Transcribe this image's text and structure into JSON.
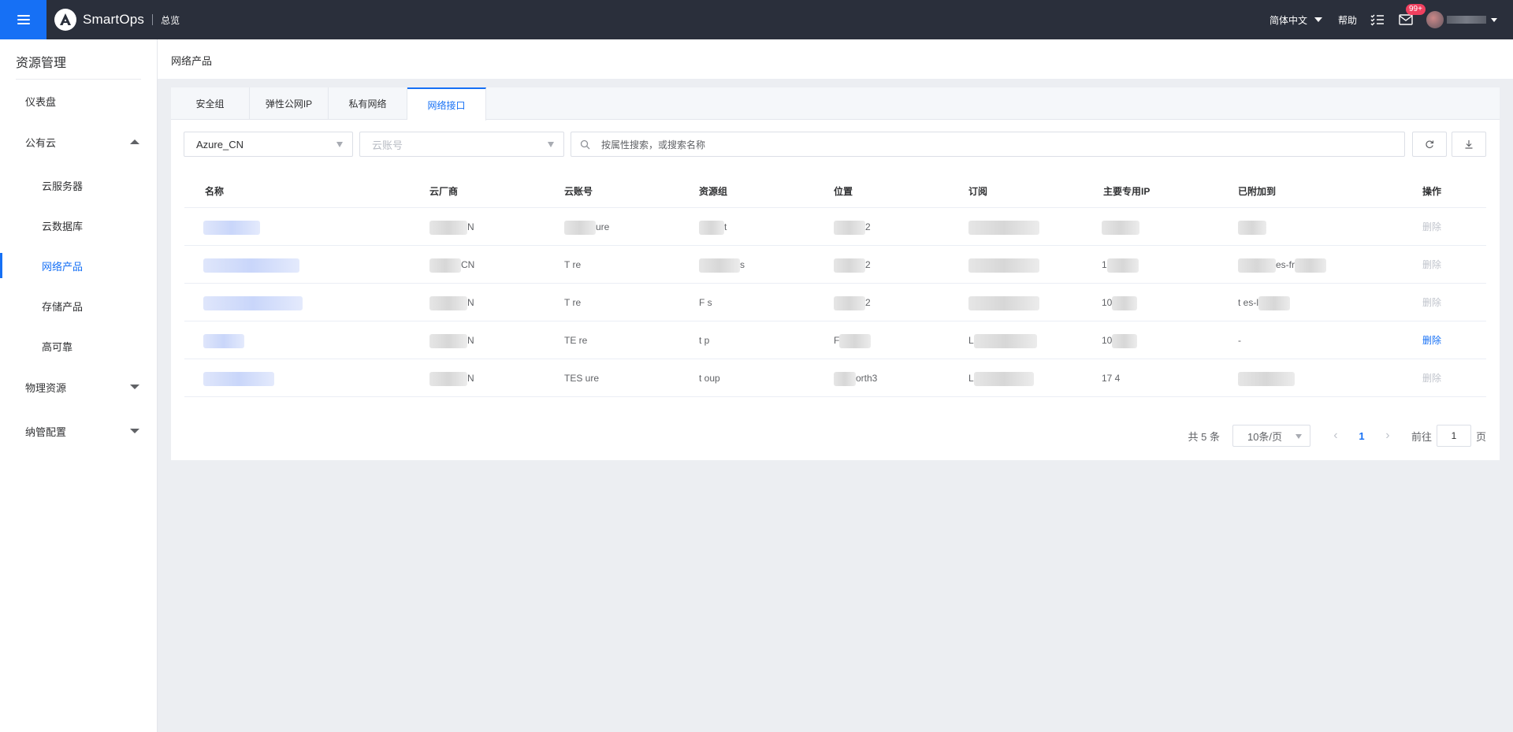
{
  "topbar": {
    "brand": "SmartOps",
    "overview": "总览",
    "language": "简体中文",
    "help": "帮助",
    "mail_badge": "99+",
    "icons": [
      "menu-icon",
      "tasks-icon",
      "mail-icon",
      "avatar"
    ]
  },
  "sidebar": {
    "title": "资源管理",
    "items": [
      {
        "label": "仪表盘"
      },
      {
        "label": "公有云"
      },
      {
        "label": "云服务器"
      },
      {
        "label": "云数据库"
      },
      {
        "label": "网络产品"
      },
      {
        "label": "存储产品"
      },
      {
        "label": "高可靠"
      },
      {
        "label": "物理资源"
      },
      {
        "label": "纳管配置"
      }
    ]
  },
  "breadcrumb": "网络产品",
  "tabs": [
    {
      "label": "安全组"
    },
    {
      "label": "弹性公网IP"
    },
    {
      "label": "私有网络"
    },
    {
      "label": "网络接口",
      "active": true
    }
  ],
  "filters": {
    "provider": "Azure_CN",
    "account_placeholder": "云账号",
    "search_placeholder": "按属性搜索，或搜索名称"
  },
  "table": {
    "columns": [
      "名称",
      "云厂商",
      "云账号",
      "资源组",
      "位置",
      "订阅",
      "主要专用IP",
      "已附加到",
      "操作"
    ],
    "rows": [
      {
        "vendor": "N",
        "account": "ure",
        "group": "t",
        "location": "2",
        "ip": "",
        "attached": "",
        "action": "删除",
        "action_enabled": false
      },
      {
        "vendor": "CN",
        "account": "T         re",
        "group": "s",
        "location": "2",
        "ip": "1",
        "attached": "es-fr",
        "action": "删除",
        "action_enabled": false
      },
      {
        "vendor": "N",
        "account": "T         re",
        "group": "F         s",
        "location": "2",
        "ip": "10",
        "attached": "t       es-l",
        "action": "删除",
        "action_enabled": false
      },
      {
        "vendor": "N",
        "account": "TE        re",
        "group": "t         p",
        "location": "F",
        "subscription": "L",
        "ip": "10",
        "attached": "-",
        "action": "删除",
        "action_enabled": true
      },
      {
        "vendor": "N",
        "account": "TES       ure",
        "group": "t         oup",
        "location": "orth3",
        "subscription": "L",
        "ip": "17         4",
        "attached": "",
        "action": "删除",
        "action_enabled": false
      }
    ]
  },
  "pagination": {
    "total": "共 5 条",
    "page_size": "10条/页",
    "current": "1",
    "goto_label": "前往",
    "goto_value": "1",
    "page_suffix": "页"
  },
  "colors": {
    "accent": "#1670f5",
    "topbar": "#2a2f3b",
    "badge": "#f0405f"
  }
}
